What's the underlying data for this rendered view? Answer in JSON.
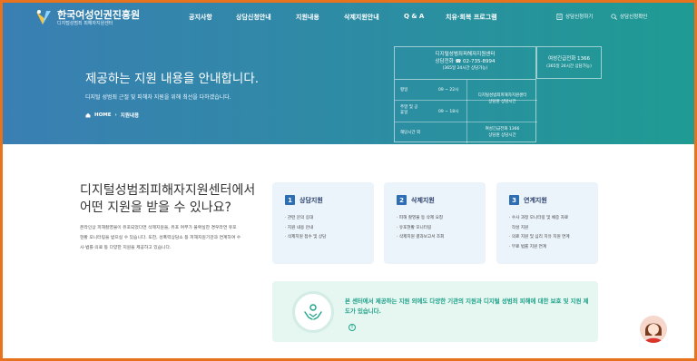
{
  "header": {
    "logo_title": "한국여성인권진흥원",
    "logo_subtitle": "디지털성범죄 피해자지원센터",
    "nav": [
      "공지사항",
      "상담신청안내",
      "지원내용",
      "삭제지원안내",
      "Q & A",
      "치유·회복 프로그램"
    ],
    "util": {
      "apply": "상담신청하기",
      "check": "상담신청확인"
    }
  },
  "hero": {
    "title": "제공하는 지원 내용을 안내합니다.",
    "description": "디지털 성범죄 근절 및 피해자 지원을 위해 최선을 다하겠습니다.",
    "breadcrumb": {
      "home": "HOME",
      "current": "지원내용"
    }
  },
  "info_box": {
    "center_name": "디지털성범죄피해자지원센터",
    "phone": "상담전화 ☎ 02-735-8994",
    "phone_note": "(365일 24시간 상담가능)",
    "rows": [
      {
        "label": "평일",
        "time": "09 ~ 22시"
      },
      {
        "label": "주말 및 공휴일",
        "time": "09 ~ 18시"
      },
      {
        "label": "해당시간 외",
        "time": ""
      }
    ],
    "right_top": [
      "디지털성범죄피해자지원센터",
      "상담원 상담시간"
    ],
    "right_bottom": [
      "여성긴급전화 1366",
      "상담원 상담시간"
    ]
  },
  "emergency": {
    "line1": "여성긴급전화 1366",
    "line2": "(365일 24시간 상담가능)"
  },
  "question": {
    "title": "디지털성범죄피해자지원센터에서 어떤 지원을 받을 수 있나요?",
    "body": "온라인상 피해촬영물이 유포되었다면 삭제지원을, 유포 여부가 불확실한 경우라면 유포 현황 모니터링을 받으실 수 있습니다. 또한, 성폭력상담소 등 피해지원기관과 연계하여 수사·법률·의료 등 다양한 지원을 제공하고 있습니다."
  },
  "cards": [
    {
      "num": "1",
      "title": "상담지원",
      "items": [
        "· 관련 문의 응대",
        "· 지원 내용 안내",
        "· 삭제지원 접수 및 상담"
      ]
    },
    {
      "num": "2",
      "title": "삭제지원",
      "items": [
        "· 피해 촬영물 등 삭제 요청",
        "· 유포현황 모니터링",
        "· 삭제지원 결과보고서 조회"
      ]
    },
    {
      "num": "3",
      "title": "연계지원",
      "items": [
        "· 수사 과정 모니터링 및 채증 자료",
        "  작성 지원",
        "· 의료 지원 및 심리 치유 지원 연계",
        "· 무료 법률 지원 연계"
      ]
    }
  ],
  "notice": {
    "text": "본 센터에서 제공하는 지원 외에도 다양한 기관의 지원과 디지털 성범죄 피해에 대한 보호 및 지원 제도가 있습니다.",
    "info_label": "!"
  },
  "colors": {
    "accent": "#2d6eb5",
    "teal": "#1fa38a",
    "border": "#e8731f"
  }
}
